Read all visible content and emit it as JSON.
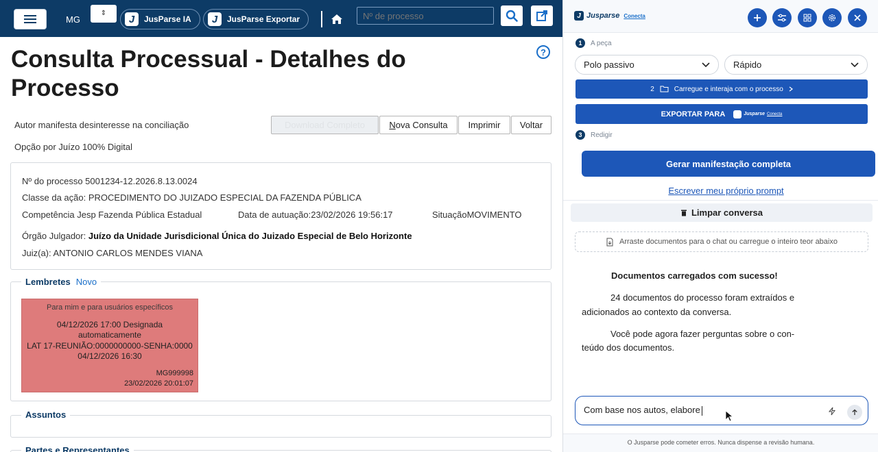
{
  "header": {
    "mg_label": "MG",
    "mg_select": "⇕",
    "jusparse_ia_label": "JusParse IA",
    "jusparse_exportar_label": "JusParse Exportar",
    "process_search_placeholder": "Nº de processo",
    "logo_letter": "J"
  },
  "page": {
    "title": "Consulta Processual - Detalhes do Processo",
    "notice1": "Autor manifesta desinteresse na conciliação",
    "notice2": "Opção por Juízo 100% Digital",
    "buttons": {
      "download": "Download Completo",
      "nova_consulta_rest": "ova Consulta",
      "nova_consulta_first": "N",
      "imprimir": "Imprimir",
      "voltar": "Voltar"
    },
    "help": "?"
  },
  "process": {
    "numero": "Nº do processo 5001234-12.2026.8.13.0024",
    "classe": "Classe da ação: PROCEDIMENTO DO JUIZADO ESPECIAL DA FAZENDA PÚBLICA",
    "competencia": "Competência Jesp Fazenda Pública Estadual",
    "data_autuacao": "Data de autuação:23/02/2026 19:56:17",
    "situacao": "SituaçãoMOVIMENTO",
    "orgao_label": "Órgão Julgador: ",
    "orgao_value": "Juízo da Unidade Jurisdicional Única do Juizado Especial de Belo Horizonte",
    "juiz": "Juiz(a): ANTONIO CARLOS MENDES VIANA"
  },
  "lembretes": {
    "legend": "Lembretes",
    "novo": "Novo",
    "reminder": {
      "audience": "Para mim e para usuários específicos",
      "line1": "04/12/2026 17:00 Designada",
      "line2": "automaticamente",
      "line3": "LAT 17-REUNIÃO:0000000000-SENHA:0000",
      "line4": "04/12/2026 16:30",
      "user": "MG999998",
      "timestamp": "23/02/2026 20:01:07"
    }
  },
  "assuntos": {
    "legend": "Assuntos"
  },
  "partes": {
    "legend": "Partes e Representantes"
  },
  "panel": {
    "brand": "Jusparse",
    "brand_sub": "Conecta",
    "step1_num": "1",
    "step1_label": "A peça",
    "dropdown1": "Polo passivo",
    "dropdown2": "Rápido",
    "step2_num": "2",
    "step2_label": "Carregue e interaja com o processo",
    "exportar_label": "EXPORTAR PARA",
    "exportar_brand": "Jusparse",
    "exportar_brand_sub": "Conecta",
    "step3_num": "3",
    "step3_label": "Redigir",
    "generate": "Gerar manifestação completa",
    "own_prompt": "Escrever meu próprio prompt",
    "clear": "Limpar conversa",
    "drop_zone": "Arraste documentos para o chat ou carregue o inteiro teor abaixo",
    "msg_title": "Documentos carregados com sucesso!",
    "msg_p1_a": "24 documentos do processo foram extraídos e",
    "msg_p1_b": "adicionados ao contexto da conversa.",
    "msg_p2_a": "Você pode agora fazer perguntas sobre o con-",
    "msg_p2_b": "teúdo dos documentos.",
    "chat_value": "Com base nos autos, elabore",
    "footer": "O Jusparse pode cometer erros. Nunca dispense a revisão humana."
  },
  "colors": {
    "header_bg": "#0d3b66",
    "accent": "#1d57b8",
    "reminder_bg": "#de7b7b"
  }
}
